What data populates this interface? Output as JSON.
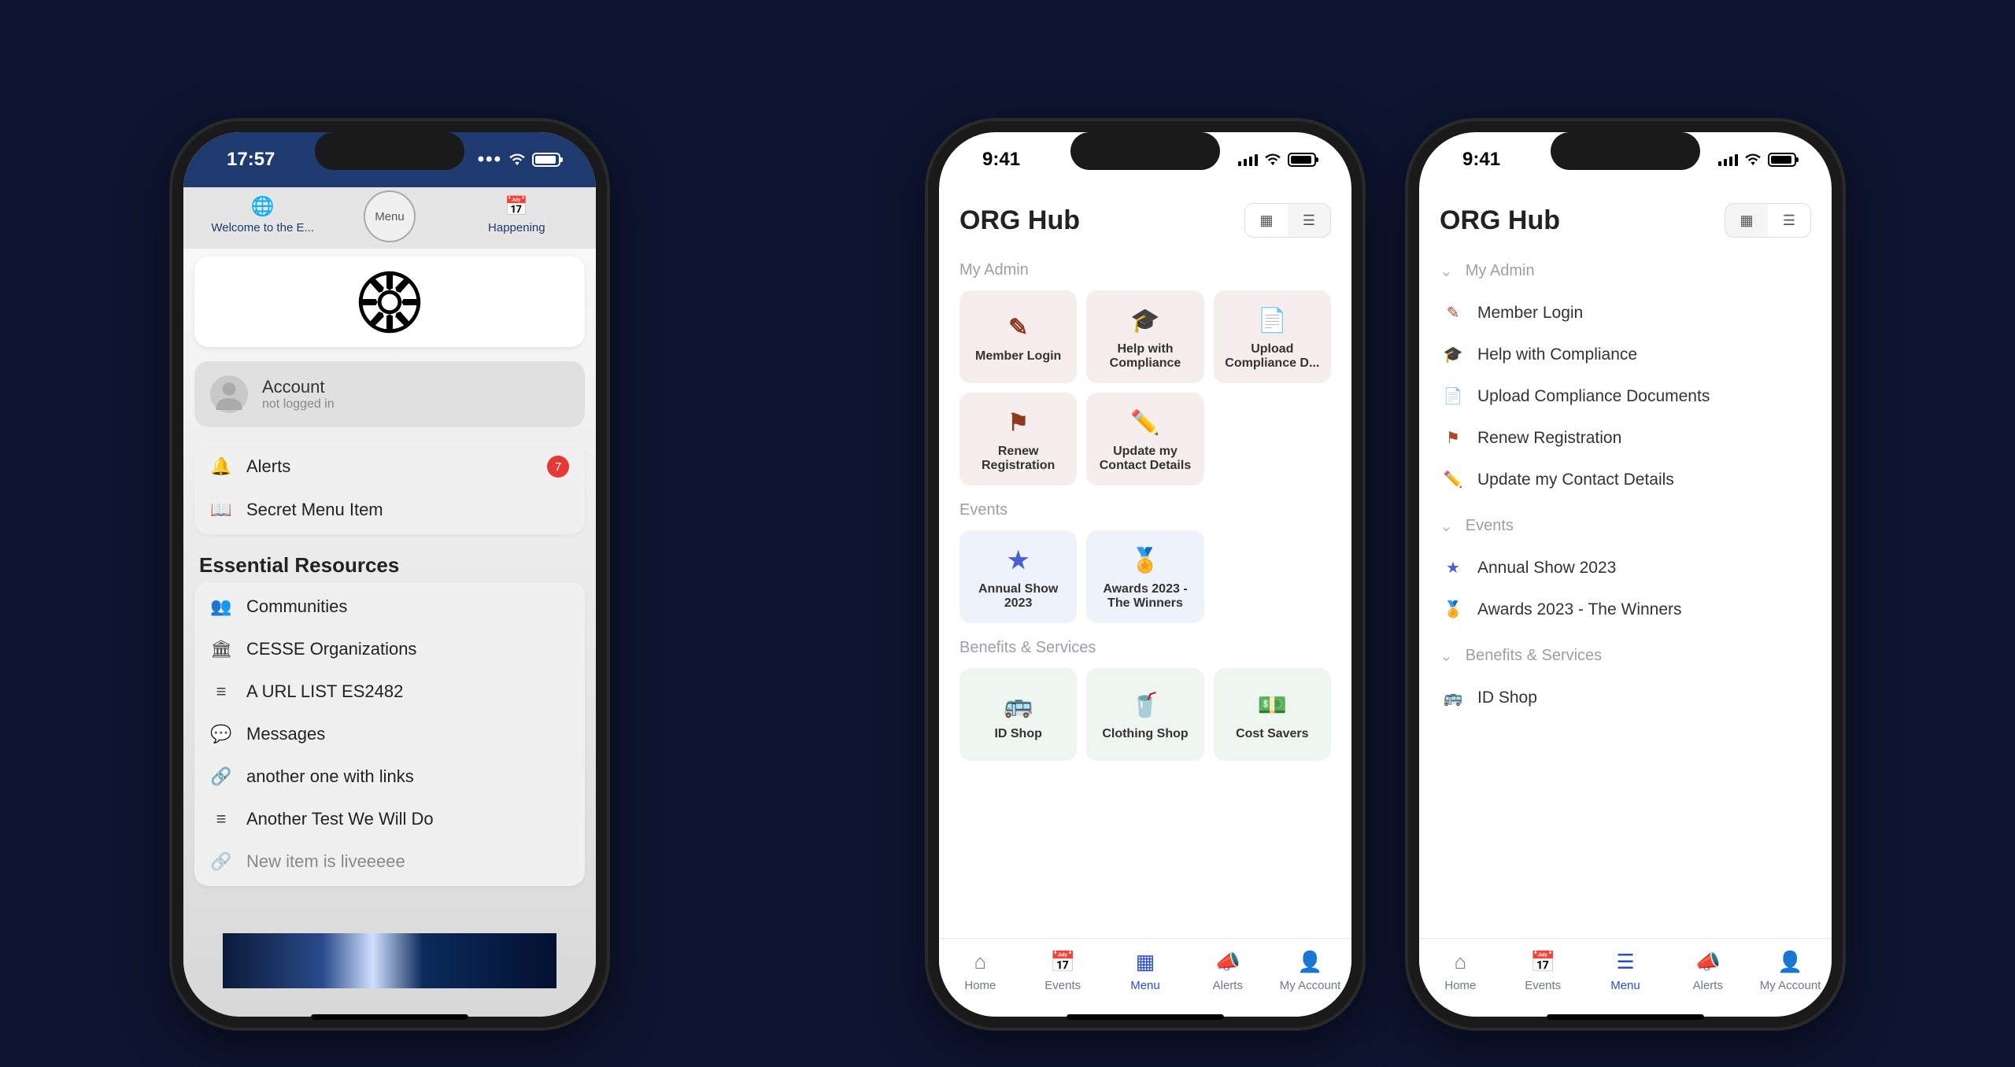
{
  "phone1": {
    "status": {
      "time": "17:57"
    },
    "topnav": {
      "left_label": "Welcome to the E...",
      "center_label": "Menu",
      "right_label": "Happening"
    },
    "account": {
      "title": "Account",
      "subtitle": "not logged in"
    },
    "alerts_label": "Alerts",
    "alerts_badge": "7",
    "secret_label": "Secret Menu Item",
    "resources_title": "Essential Resources",
    "resources": [
      "Communities",
      "CESSE Organizations",
      "A URL LIST ES2482",
      "Messages",
      "another one with links",
      "Another Test We Will Do",
      "New item is liveeeee"
    ]
  },
  "hub": {
    "status_time": "9:41",
    "title": "ORG Hub",
    "sections": {
      "admin_label": "My Admin",
      "events_label": "Events",
      "benefits_label": "Benefits & Services"
    },
    "admin": [
      "Member Login",
      "Help with Compliance",
      "Upload Compliance D...",
      "Renew Registration",
      "Update my Contact Details"
    ],
    "admin_full": [
      "Member Login",
      "Help with Compliance",
      "Upload Compliance Documents",
      "Renew Registration",
      "Update my Contact Details"
    ],
    "events": [
      "Annual Show 2023",
      "Awards 2023 - The Winners"
    ],
    "benefits": [
      "ID Shop",
      "Clothing Shop",
      "Cost Savers"
    ],
    "tabs": {
      "home": "Home",
      "events": "Events",
      "menu": "Menu",
      "alerts": "Alerts",
      "account": "My Account"
    }
  }
}
